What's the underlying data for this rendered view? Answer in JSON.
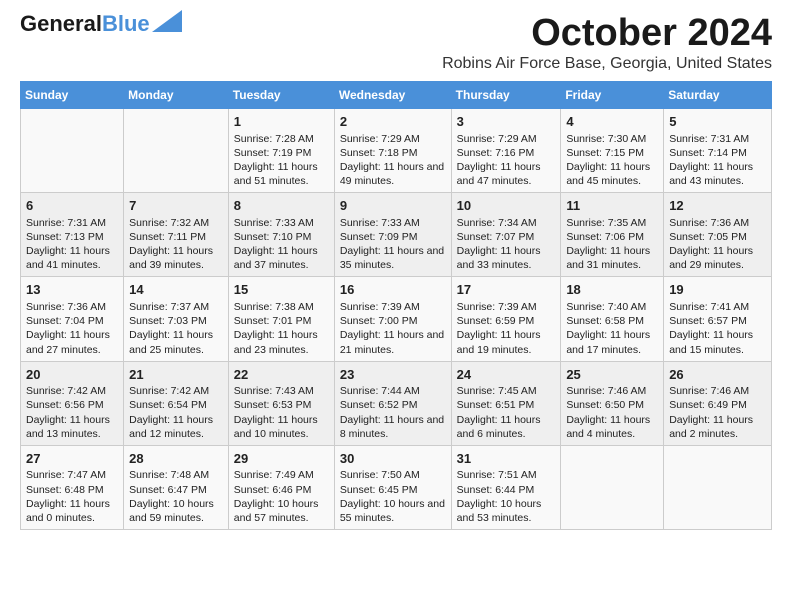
{
  "header": {
    "logo_line1": "General",
    "logo_line2": "Blue",
    "month": "October 2024",
    "location": "Robins Air Force Base, Georgia, United States"
  },
  "columns": [
    "Sunday",
    "Monday",
    "Tuesday",
    "Wednesday",
    "Thursday",
    "Friday",
    "Saturday"
  ],
  "weeks": [
    [
      {
        "day": "",
        "sunrise": "",
        "sunset": "",
        "daylight": ""
      },
      {
        "day": "",
        "sunrise": "",
        "sunset": "",
        "daylight": ""
      },
      {
        "day": "1",
        "sunrise": "Sunrise: 7:28 AM",
        "sunset": "Sunset: 7:19 PM",
        "daylight": "Daylight: 11 hours and 51 minutes."
      },
      {
        "day": "2",
        "sunrise": "Sunrise: 7:29 AM",
        "sunset": "Sunset: 7:18 PM",
        "daylight": "Daylight: 11 hours and 49 minutes."
      },
      {
        "day": "3",
        "sunrise": "Sunrise: 7:29 AM",
        "sunset": "Sunset: 7:16 PM",
        "daylight": "Daylight: 11 hours and 47 minutes."
      },
      {
        "day": "4",
        "sunrise": "Sunrise: 7:30 AM",
        "sunset": "Sunset: 7:15 PM",
        "daylight": "Daylight: 11 hours and 45 minutes."
      },
      {
        "day": "5",
        "sunrise": "Sunrise: 7:31 AM",
        "sunset": "Sunset: 7:14 PM",
        "daylight": "Daylight: 11 hours and 43 minutes."
      }
    ],
    [
      {
        "day": "6",
        "sunrise": "Sunrise: 7:31 AM",
        "sunset": "Sunset: 7:13 PM",
        "daylight": "Daylight: 11 hours and 41 minutes."
      },
      {
        "day": "7",
        "sunrise": "Sunrise: 7:32 AM",
        "sunset": "Sunset: 7:11 PM",
        "daylight": "Daylight: 11 hours and 39 minutes."
      },
      {
        "day": "8",
        "sunrise": "Sunrise: 7:33 AM",
        "sunset": "Sunset: 7:10 PM",
        "daylight": "Daylight: 11 hours and 37 minutes."
      },
      {
        "day": "9",
        "sunrise": "Sunrise: 7:33 AM",
        "sunset": "Sunset: 7:09 PM",
        "daylight": "Daylight: 11 hours and 35 minutes."
      },
      {
        "day": "10",
        "sunrise": "Sunrise: 7:34 AM",
        "sunset": "Sunset: 7:07 PM",
        "daylight": "Daylight: 11 hours and 33 minutes."
      },
      {
        "day": "11",
        "sunrise": "Sunrise: 7:35 AM",
        "sunset": "Sunset: 7:06 PM",
        "daylight": "Daylight: 11 hours and 31 minutes."
      },
      {
        "day": "12",
        "sunrise": "Sunrise: 7:36 AM",
        "sunset": "Sunset: 7:05 PM",
        "daylight": "Daylight: 11 hours and 29 minutes."
      }
    ],
    [
      {
        "day": "13",
        "sunrise": "Sunrise: 7:36 AM",
        "sunset": "Sunset: 7:04 PM",
        "daylight": "Daylight: 11 hours and 27 minutes."
      },
      {
        "day": "14",
        "sunrise": "Sunrise: 7:37 AM",
        "sunset": "Sunset: 7:03 PM",
        "daylight": "Daylight: 11 hours and 25 minutes."
      },
      {
        "day": "15",
        "sunrise": "Sunrise: 7:38 AM",
        "sunset": "Sunset: 7:01 PM",
        "daylight": "Daylight: 11 hours and 23 minutes."
      },
      {
        "day": "16",
        "sunrise": "Sunrise: 7:39 AM",
        "sunset": "Sunset: 7:00 PM",
        "daylight": "Daylight: 11 hours and 21 minutes."
      },
      {
        "day": "17",
        "sunrise": "Sunrise: 7:39 AM",
        "sunset": "Sunset: 6:59 PM",
        "daylight": "Daylight: 11 hours and 19 minutes."
      },
      {
        "day": "18",
        "sunrise": "Sunrise: 7:40 AM",
        "sunset": "Sunset: 6:58 PM",
        "daylight": "Daylight: 11 hours and 17 minutes."
      },
      {
        "day": "19",
        "sunrise": "Sunrise: 7:41 AM",
        "sunset": "Sunset: 6:57 PM",
        "daylight": "Daylight: 11 hours and 15 minutes."
      }
    ],
    [
      {
        "day": "20",
        "sunrise": "Sunrise: 7:42 AM",
        "sunset": "Sunset: 6:56 PM",
        "daylight": "Daylight: 11 hours and 13 minutes."
      },
      {
        "day": "21",
        "sunrise": "Sunrise: 7:42 AM",
        "sunset": "Sunset: 6:54 PM",
        "daylight": "Daylight: 11 hours and 12 minutes."
      },
      {
        "day": "22",
        "sunrise": "Sunrise: 7:43 AM",
        "sunset": "Sunset: 6:53 PM",
        "daylight": "Daylight: 11 hours and 10 minutes."
      },
      {
        "day": "23",
        "sunrise": "Sunrise: 7:44 AM",
        "sunset": "Sunset: 6:52 PM",
        "daylight": "Daylight: 11 hours and 8 minutes."
      },
      {
        "day": "24",
        "sunrise": "Sunrise: 7:45 AM",
        "sunset": "Sunset: 6:51 PM",
        "daylight": "Daylight: 11 hours and 6 minutes."
      },
      {
        "day": "25",
        "sunrise": "Sunrise: 7:46 AM",
        "sunset": "Sunset: 6:50 PM",
        "daylight": "Daylight: 11 hours and 4 minutes."
      },
      {
        "day": "26",
        "sunrise": "Sunrise: 7:46 AM",
        "sunset": "Sunset: 6:49 PM",
        "daylight": "Daylight: 11 hours and 2 minutes."
      }
    ],
    [
      {
        "day": "27",
        "sunrise": "Sunrise: 7:47 AM",
        "sunset": "Sunset: 6:48 PM",
        "daylight": "Daylight: 11 hours and 0 minutes."
      },
      {
        "day": "28",
        "sunrise": "Sunrise: 7:48 AM",
        "sunset": "Sunset: 6:47 PM",
        "daylight": "Daylight: 10 hours and 59 minutes."
      },
      {
        "day": "29",
        "sunrise": "Sunrise: 7:49 AM",
        "sunset": "Sunset: 6:46 PM",
        "daylight": "Daylight: 10 hours and 57 minutes."
      },
      {
        "day": "30",
        "sunrise": "Sunrise: 7:50 AM",
        "sunset": "Sunset: 6:45 PM",
        "daylight": "Daylight: 10 hours and 55 minutes."
      },
      {
        "day": "31",
        "sunrise": "Sunrise: 7:51 AM",
        "sunset": "Sunset: 6:44 PM",
        "daylight": "Daylight: 10 hours and 53 minutes."
      },
      {
        "day": "",
        "sunrise": "",
        "sunset": "",
        "daylight": ""
      },
      {
        "day": "",
        "sunrise": "",
        "sunset": "",
        "daylight": ""
      }
    ]
  ]
}
